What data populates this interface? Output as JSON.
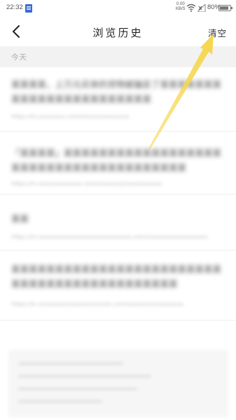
{
  "status_bar": {
    "time": "22:32",
    "net_speed_value": "0.00",
    "net_speed_unit": "KB/S",
    "battery": "80%"
  },
  "nav": {
    "title": "浏览历史",
    "clear_label": "清空"
  },
  "section": {
    "label": "今天"
  },
  "history": {
    "items": [
      {
        "title": "某某某某，上万元买来的货物被骗走了某某某某某某某某某某某某某某某某某某某某某某某",
        "url": "https://m.xxxxxxxx.com/xxxxxx/xxxxxxxx"
      },
      {
        "title": "「某某某某」某某某某某某某某某某某某某某某某某某某某某某某某某某某某某某某某某某某某某某",
        "url": "https://m.xxxxxxxxxxxxx.com/xxxxxxxx/xxxxxxxxxxx"
      },
      {
        "title": "某某",
        "url": "https://m.xxxxxxxxxxxxxxxxxxxxxxxxxxxx.com/xxxxxxxxxxxxxxxxxxxxxxxxxxxxx"
      },
      {
        "title": "某某某某某某某某某某某某某某某某某某某某某某某某某某某某某某某某某某某某某某某某某某某",
        "url": "https://m.xxxxxxxxxxxxxxxxxxxxxx.com/xxxxxxxxxxxxxxxxx"
      }
    ]
  },
  "colors": {
    "annotation_arrow": "#f5d64a",
    "section_bg": "#f2f2f2"
  },
  "icons": {
    "back": "chevron-left-icon",
    "wifi": "wifi-icon",
    "signal": "signal-icon",
    "battery": "battery-icon",
    "notification": "document-icon"
  }
}
